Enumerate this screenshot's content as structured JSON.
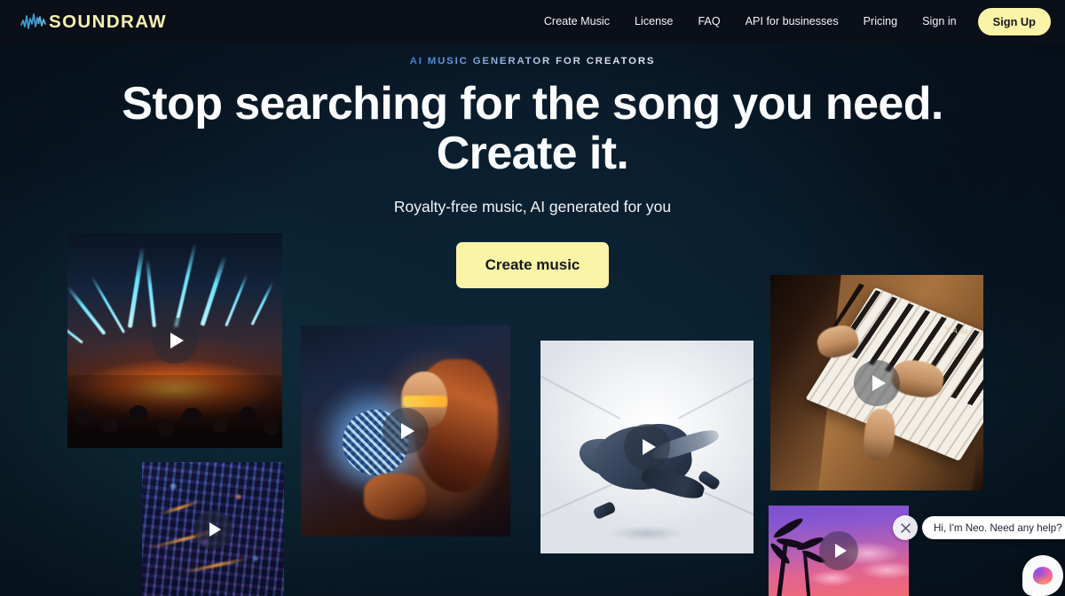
{
  "nav": {
    "logo_text": "SOUNDRAW",
    "logo_icon": "waveform-icon",
    "links": [
      {
        "label": "Create Music"
      },
      {
        "label": "License"
      },
      {
        "label": "FAQ"
      },
      {
        "label": "API for businesses"
      },
      {
        "label": "Pricing"
      },
      {
        "label": "Sign in"
      }
    ],
    "signup_label": "Sign Up",
    "accent_color": "#fbf3a6",
    "bar_color": "#0b0f18"
  },
  "hero": {
    "eyebrow": "AI MUSIC GENERATOR FOR CREATORS",
    "headline_line1": "Stop searching for the song you need.",
    "headline_line2": "Create it.",
    "subtitle": "Royalty-free music, AI generated for you",
    "cta_label": "Create music"
  },
  "media": {
    "play_icon": "play-icon",
    "tiles": [
      {
        "id": "tile-concert",
        "name": "concert-laser-stage"
      },
      {
        "id": "tile-city",
        "name": "night-cityscape"
      },
      {
        "id": "tile-disco",
        "name": "woman-with-disco-ball"
      },
      {
        "id": "tile-dancer",
        "name": "breakdancer-white-corridor"
      },
      {
        "id": "tile-piano",
        "name": "hands-playing-piano"
      },
      {
        "id": "tile-sunset",
        "name": "tropical-palm-sunset"
      }
    ],
    "piano_brand_text": "YAM"
  },
  "chat": {
    "message": "Hi, I'm Neo. Need any help?",
    "close_icon": "close-icon",
    "avatar_icon": "brain-avatar-icon"
  },
  "theme": {
    "background": "#0a2231",
    "text_primary": "#fafcfe"
  }
}
